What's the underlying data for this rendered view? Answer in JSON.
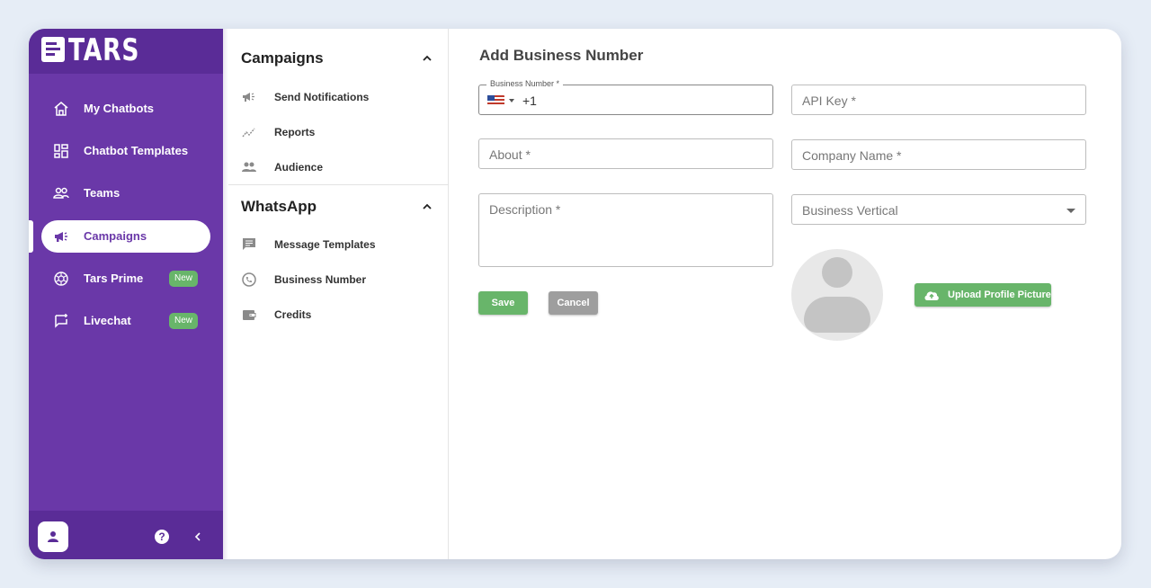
{
  "brand": {
    "name": "TARS"
  },
  "colors": {
    "sidebar": "#6a38a8",
    "sidebar_dark": "#5a2c97",
    "accent_green": "#68b56a",
    "cancel_grey": "#9e9e9e",
    "background": "#e6edf6"
  },
  "sidebar": {
    "items": [
      {
        "label": "My Chatbots",
        "icon": "home-icon"
      },
      {
        "label": "Chatbot Templates",
        "icon": "templates-grid-icon"
      },
      {
        "label": "Teams",
        "icon": "teams-icon"
      },
      {
        "label": "Campaigns",
        "icon": "megaphone-icon",
        "active": true
      },
      {
        "label": "Tars Prime",
        "icon": "openai-icon",
        "badge": "New"
      },
      {
        "label": "Livechat",
        "icon": "livechat-icon",
        "badge": "New"
      }
    ],
    "footer": {
      "help": "?"
    }
  },
  "menu": {
    "sections": [
      {
        "title": "Campaigns",
        "items": [
          {
            "label": "Send Notifications",
            "icon": "megaphone-icon"
          },
          {
            "label": "Reports",
            "icon": "trend-icon"
          },
          {
            "label": "Audience",
            "icon": "people-icon"
          }
        ]
      },
      {
        "title": "WhatsApp",
        "items": [
          {
            "label": "Message Templates",
            "icon": "message-icon"
          },
          {
            "label": "Business Number",
            "icon": "whatsapp-icon"
          },
          {
            "label": "Credits",
            "icon": "wallet-icon"
          }
        ]
      }
    ]
  },
  "form": {
    "title": "Add Business Number",
    "business_number": {
      "label": "Business Number *",
      "dial_code": "+1",
      "country": "US"
    },
    "api_key": {
      "placeholder": "API Key *"
    },
    "about": {
      "placeholder": "About *"
    },
    "company_name": {
      "placeholder": "Company Name *"
    },
    "description": {
      "placeholder": "Description *"
    },
    "business_vertical": {
      "placeholder": "Business Vertical"
    },
    "save_label": "Save",
    "cancel_label": "Cancel",
    "upload_label": "Upload Profile Picture"
  }
}
